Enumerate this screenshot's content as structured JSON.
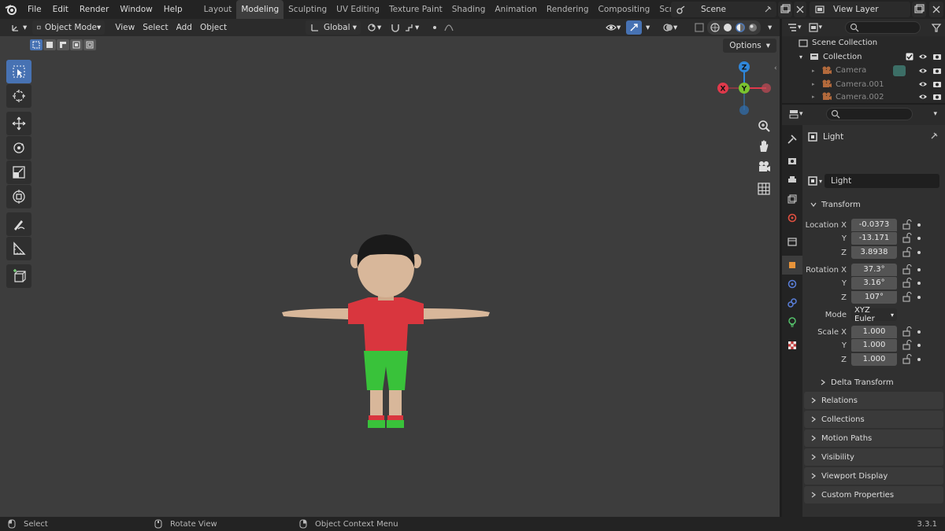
{
  "topbar": {
    "menus": [
      "File",
      "Edit",
      "Render",
      "Window",
      "Help"
    ],
    "workspaces": [
      "Layout",
      "Modeling",
      "Sculpting",
      "UV Editing",
      "Texture Paint",
      "Shading",
      "Animation",
      "Rendering",
      "Compositing",
      "Scripting"
    ],
    "active_workspace": "Modeling",
    "scene_name": "Scene",
    "view_layer": "View Layer"
  },
  "viewport_header": {
    "mode": "Object Mode",
    "menus": [
      "View",
      "Select",
      "Add",
      "Object"
    ],
    "orientation": "Global",
    "options_label": "Options"
  },
  "gizmo": {
    "x": "X",
    "y": "Y",
    "z": "Z",
    "colors": {
      "x": "#e0394b",
      "y": "#7ac430",
      "z": "#2f86d9"
    }
  },
  "outliner": {
    "root": "Scene Collection",
    "collection": "Collection",
    "items": [
      "Camera",
      "Camera.001",
      "Camera.002"
    ]
  },
  "properties": {
    "object_name": "Light",
    "data_name": "Light",
    "transform_label": "Transform",
    "location": {
      "label": "Location X",
      "x": "-0.0373",
      "y": "-13.171",
      "z": "3.8938"
    },
    "rotation": {
      "label": "Rotation X",
      "x": "37.3°",
      "y": "3.16°",
      "z": "107°"
    },
    "mode_label": "Mode",
    "mode_value": "XYZ Euler",
    "scale": {
      "label": "Scale X",
      "x": "1.000",
      "y": "1.000",
      "z": "1.000"
    },
    "axis_y": "Y",
    "axis_z": "Z",
    "delta_transform": "Delta Transform",
    "panels": [
      "Relations",
      "Collections",
      "Motion Paths",
      "Visibility",
      "Viewport Display",
      "Custom Properties"
    ]
  },
  "statusbar": {
    "select": "Select",
    "rotate": "Rotate View",
    "context": "Object Context Menu",
    "version": "3.3.1"
  },
  "colors": {
    "accent": "#4772b3",
    "viewport_bg": "#3d3d3d",
    "shirt": "#d9363e",
    "shorts": "#39c23a",
    "skin": "#d8b79a",
    "hair": "#1a1a1a"
  }
}
